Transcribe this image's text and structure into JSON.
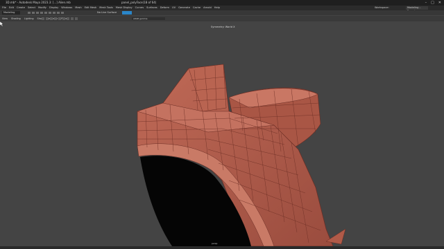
{
  "window": {
    "title": "3D.mb* - Autodesk Maya 2023.3: [...] Alien.mb",
    "search_text": "...",
    "path_text": "panel_polyFace(18 of 64)"
  },
  "menu": {
    "items": [
      "File",
      "Edit",
      "Create",
      "Select",
      "Modify",
      "Display",
      "Windows",
      "Mesh",
      "Edit Mesh",
      "Mesh Tools",
      "Mesh Display",
      "Curves",
      "Surfaces",
      "Deform",
      "UV",
      "Generate",
      "Cache",
      "Arnold",
      "Help"
    ],
    "workspace_label": "Workspace:",
    "workspace_value": "Modeling – Expert"
  },
  "status": {
    "mode_value": "Modeling",
    "live_label": "No Live Surface"
  },
  "panel": {
    "menus": [
      "View",
      "Shading",
      "Lighting",
      "Show",
      "Renderer",
      "Panels"
    ],
    "camera_value": "sRGB gamma",
    "viewport_label": "Symmetry: World X",
    "bottom_label": "persp"
  },
  "icons": [
    "close-icon",
    "minimize-icon",
    "maximize-icon",
    "select-tool-icon",
    "move-tool-icon",
    "rotate-tool-icon",
    "scale-tool-icon",
    "mouse-cursor-icon"
  ],
  "colors": {
    "mesh_fill": "#b5604f",
    "mesh_dark": "#8f4537",
    "mesh_wire": "#6a2d24",
    "viewport_bg": "#444444",
    "accent": "#2a86c9"
  }
}
